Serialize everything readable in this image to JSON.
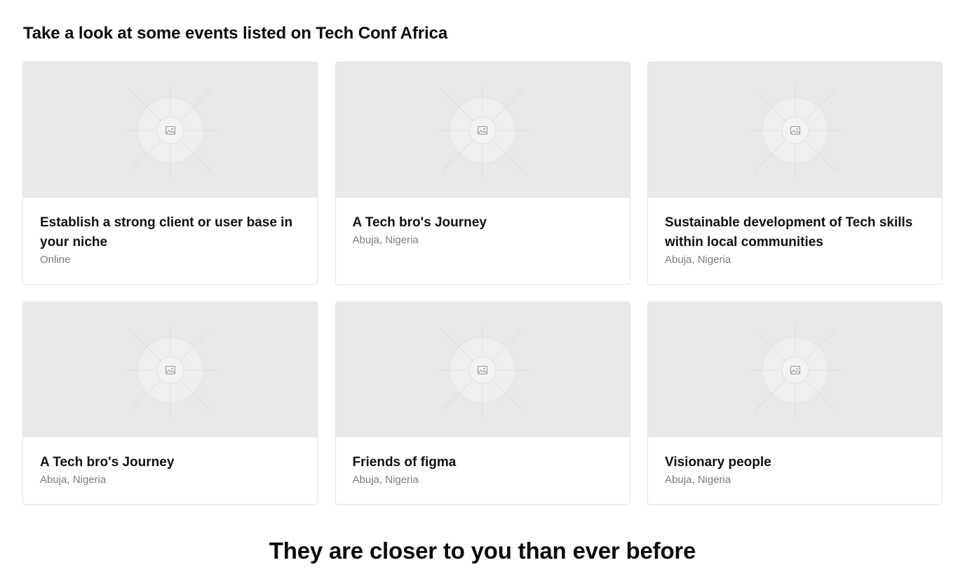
{
  "section": {
    "title": "Take a look at some events listed on Tech Conf Africa"
  },
  "events": [
    {
      "title": "Establish a strong client or user base in your niche",
      "location": "Online",
      "image_icon": "image-placeholder-icon"
    },
    {
      "title": "A Tech bro's Journey",
      "location": "Abuja, Nigeria",
      "image_icon": "image-placeholder-icon"
    },
    {
      "title": "Sustainable development of Tech skills within local communities",
      "location": "Abuja, Nigeria",
      "image_icon": "image-placeholder-icon"
    },
    {
      "title": "A Tech bro's Journey",
      "location": "Abuja, Nigeria",
      "image_icon": "image-placeholder-icon"
    },
    {
      "title": "Friends of figma",
      "location": "Abuja, Nigeria",
      "image_icon": "image-placeholder-icon"
    },
    {
      "title": "Visionary people",
      "location": "Abuja, Nigeria",
      "image_icon": "image-placeholder-icon"
    }
  ],
  "closing": {
    "heading": "They are closer to you than ever before"
  },
  "colors": {
    "placeholder_bg": "#e9e9e9",
    "title_text": "#111111",
    "location_text": "#7a7a7a",
    "card_border": "#e3e3e3"
  }
}
